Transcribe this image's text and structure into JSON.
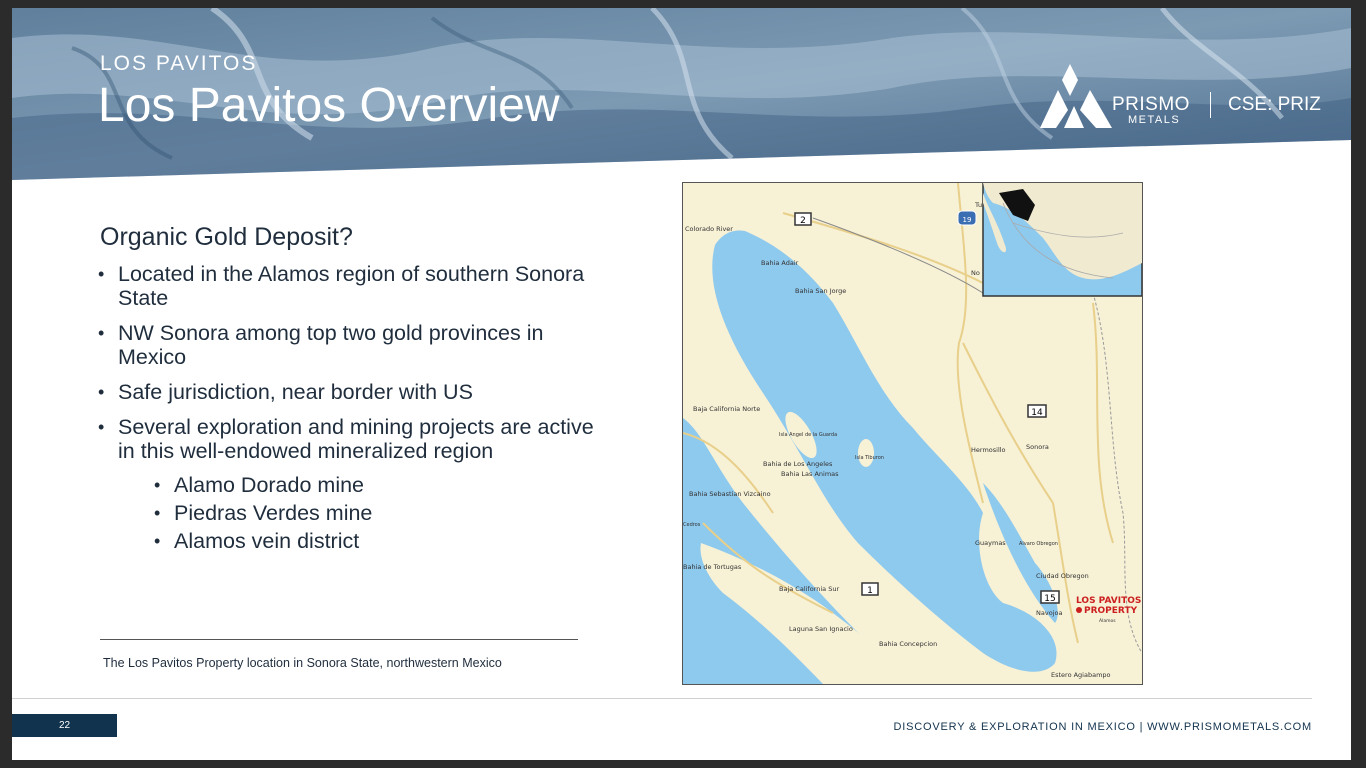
{
  "header": {
    "kicker": "LOS PAVITOS",
    "title": "Los Pavitos Overview",
    "brand": "PRISMO",
    "brand_sub": "METALS",
    "ticker": "CSE: PRIZ"
  },
  "content": {
    "heading": "Organic Gold Deposit?",
    "bullets": [
      "Located in the Alamos region of southern Sonora State",
      "NW Sonora among top two gold provinces in Mexico",
      "Safe jurisdiction, near border with US",
      "Several exploration and mining projects are active in this well-endowed  mineralized region"
    ],
    "sub_bullets": [
      "Alamo Dorado mine",
      "Piedras Verdes mine",
      "Alamos vein district"
    ],
    "caption": "The Los Pavitos Property location in Sonora State, northwestern Mexico"
  },
  "map": {
    "labels": {
      "colorado_river": "Colorado River",
      "bahia_adair": "Bahia Adair",
      "bahia_san_jorge": "Bahia San Jorge",
      "baja_norte": "Baja California Norte",
      "isla_angel": "Isla Angel de la Guarda",
      "isla_tiburon": "Isla Tiburon",
      "bahia_angeles": "Bahia de Los Angeles",
      "bahia_animas": "Bahia Las Animas",
      "bahia_vizcaino": "Bahia Sebastian Vizcaino",
      "cedros": "Cedros",
      "bahia_tortugas": "Bahia de Tortugas",
      "baja_sur": "Baja California Sur",
      "laguna": "Laguna San Ignacio",
      "bahia_concepcion": "Bahia Concepcion",
      "hermosillo": "Hermosillo",
      "sonora": "Sonora",
      "guaymas": "Guaymas",
      "alvaro": "Alvaro Obregon",
      "ciudad_obregon": "Ciudad Obregon",
      "navojoa": "Navojoa",
      "alamos": "Alamos",
      "estero": "Estero Agiabampo",
      "no": "No",
      "tu": "Tu",
      "property_1": "LOS PAVITOS",
      "property_2": "PROPERTY"
    },
    "highways": {
      "h2": "2",
      "h14": "14",
      "h1": "1",
      "h15": "15",
      "h19": "19"
    },
    "colors": {
      "land": "#f7f1d6",
      "water": "#8ec9ee",
      "road": "#e8cf8a",
      "marker": "#cc1f1f"
    }
  },
  "footer": {
    "page_number": "22",
    "tagline": "DISCOVERY & EXPLORATION IN MEXICO   |   WWW.PRISMOMETALS.COM"
  }
}
